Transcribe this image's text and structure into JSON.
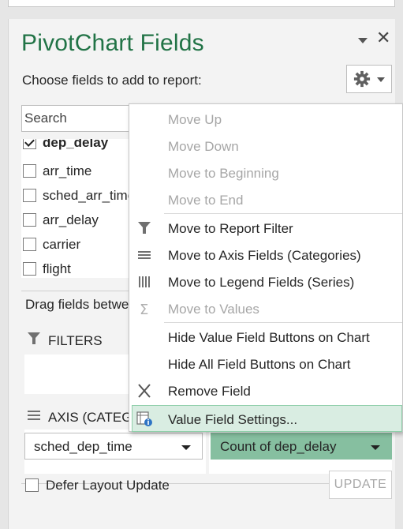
{
  "panel": {
    "title": "PivotChart Fields",
    "subtitle": "Choose fields to add to report:",
    "search_placeholder": "Search"
  },
  "fields": [
    {
      "label": "dep_delay",
      "checked": true,
      "bold": true
    },
    {
      "label": "arr_time",
      "checked": false
    },
    {
      "label": "sched_arr_time",
      "checked": false
    },
    {
      "label": "arr_delay",
      "checked": false
    },
    {
      "label": "carrier",
      "checked": false
    },
    {
      "label": "flight",
      "checked": false
    }
  ],
  "areas": {
    "drag_text": "Drag fields betwe",
    "filters_label": "FILTERS",
    "axis_label": "AXIS (CATEG",
    "axis_field": "sched_dep_time",
    "values_field": "Count of dep_delay"
  },
  "footer": {
    "defer_label": "Defer Layout Update",
    "update_label": "UPDATE"
  },
  "context_menu": {
    "move_up": "Move Up",
    "move_down": "Move Down",
    "move_to_beginning": "Move to Beginning",
    "move_to_end": "Move to End",
    "move_to_report_filter": "Move to Report Filter",
    "move_to_axis_fields": "Move to Axis Fields (Categories)",
    "move_to_legend_fields": "Move to Legend Fields (Series)",
    "move_to_values": "Move to Values",
    "hide_value_field_buttons": "Hide Value Field Buttons on Chart",
    "hide_all_field_buttons": "Hide All Field Buttons on Chart",
    "remove_field": "Remove Field",
    "value_field_settings": "Value Field Settings..."
  },
  "colors": {
    "accent": "#217346",
    "values_pill": "#86bfa0",
    "menu_highlight": "#d9ede2"
  }
}
